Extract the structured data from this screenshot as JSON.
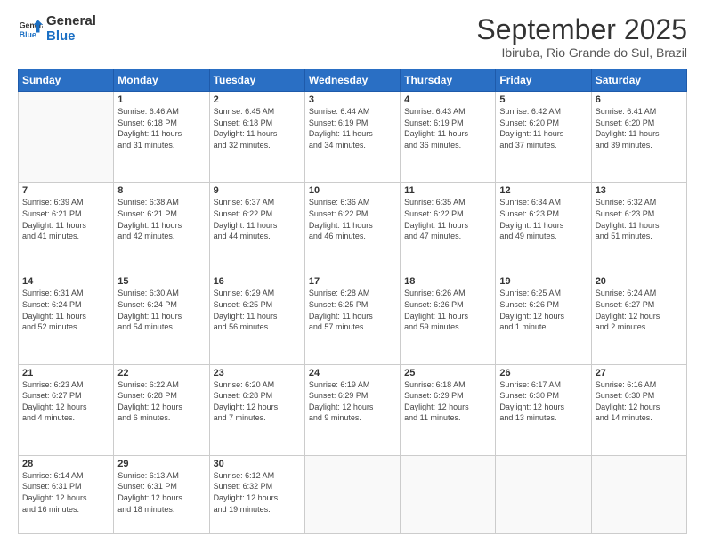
{
  "logo": {
    "general": "General",
    "blue": "Blue"
  },
  "header": {
    "month": "September 2025",
    "location": "Ibiruba, Rio Grande do Sul, Brazil"
  },
  "weekdays": [
    "Sunday",
    "Monday",
    "Tuesday",
    "Wednesday",
    "Thursday",
    "Friday",
    "Saturday"
  ],
  "weeks": [
    [
      {
        "day": "",
        "info": ""
      },
      {
        "day": "1",
        "info": "Sunrise: 6:46 AM\nSunset: 6:18 PM\nDaylight: 11 hours\nand 31 minutes."
      },
      {
        "day": "2",
        "info": "Sunrise: 6:45 AM\nSunset: 6:18 PM\nDaylight: 11 hours\nand 32 minutes."
      },
      {
        "day": "3",
        "info": "Sunrise: 6:44 AM\nSunset: 6:19 PM\nDaylight: 11 hours\nand 34 minutes."
      },
      {
        "day": "4",
        "info": "Sunrise: 6:43 AM\nSunset: 6:19 PM\nDaylight: 11 hours\nand 36 minutes."
      },
      {
        "day": "5",
        "info": "Sunrise: 6:42 AM\nSunset: 6:20 PM\nDaylight: 11 hours\nand 37 minutes."
      },
      {
        "day": "6",
        "info": "Sunrise: 6:41 AM\nSunset: 6:20 PM\nDaylight: 11 hours\nand 39 minutes."
      }
    ],
    [
      {
        "day": "7",
        "info": "Sunrise: 6:39 AM\nSunset: 6:21 PM\nDaylight: 11 hours\nand 41 minutes."
      },
      {
        "day": "8",
        "info": "Sunrise: 6:38 AM\nSunset: 6:21 PM\nDaylight: 11 hours\nand 42 minutes."
      },
      {
        "day": "9",
        "info": "Sunrise: 6:37 AM\nSunset: 6:22 PM\nDaylight: 11 hours\nand 44 minutes."
      },
      {
        "day": "10",
        "info": "Sunrise: 6:36 AM\nSunset: 6:22 PM\nDaylight: 11 hours\nand 46 minutes."
      },
      {
        "day": "11",
        "info": "Sunrise: 6:35 AM\nSunset: 6:22 PM\nDaylight: 11 hours\nand 47 minutes."
      },
      {
        "day": "12",
        "info": "Sunrise: 6:34 AM\nSunset: 6:23 PM\nDaylight: 11 hours\nand 49 minutes."
      },
      {
        "day": "13",
        "info": "Sunrise: 6:32 AM\nSunset: 6:23 PM\nDaylight: 11 hours\nand 51 minutes."
      }
    ],
    [
      {
        "day": "14",
        "info": "Sunrise: 6:31 AM\nSunset: 6:24 PM\nDaylight: 11 hours\nand 52 minutes."
      },
      {
        "day": "15",
        "info": "Sunrise: 6:30 AM\nSunset: 6:24 PM\nDaylight: 11 hours\nand 54 minutes."
      },
      {
        "day": "16",
        "info": "Sunrise: 6:29 AM\nSunset: 6:25 PM\nDaylight: 11 hours\nand 56 minutes."
      },
      {
        "day": "17",
        "info": "Sunrise: 6:28 AM\nSunset: 6:25 PM\nDaylight: 11 hours\nand 57 minutes."
      },
      {
        "day": "18",
        "info": "Sunrise: 6:26 AM\nSunset: 6:26 PM\nDaylight: 11 hours\nand 59 minutes."
      },
      {
        "day": "19",
        "info": "Sunrise: 6:25 AM\nSunset: 6:26 PM\nDaylight: 12 hours\nand 1 minute."
      },
      {
        "day": "20",
        "info": "Sunrise: 6:24 AM\nSunset: 6:27 PM\nDaylight: 12 hours\nand 2 minutes."
      }
    ],
    [
      {
        "day": "21",
        "info": "Sunrise: 6:23 AM\nSunset: 6:27 PM\nDaylight: 12 hours\nand 4 minutes."
      },
      {
        "day": "22",
        "info": "Sunrise: 6:22 AM\nSunset: 6:28 PM\nDaylight: 12 hours\nand 6 minutes."
      },
      {
        "day": "23",
        "info": "Sunrise: 6:20 AM\nSunset: 6:28 PM\nDaylight: 12 hours\nand 7 minutes."
      },
      {
        "day": "24",
        "info": "Sunrise: 6:19 AM\nSunset: 6:29 PM\nDaylight: 12 hours\nand 9 minutes."
      },
      {
        "day": "25",
        "info": "Sunrise: 6:18 AM\nSunset: 6:29 PM\nDaylight: 12 hours\nand 11 minutes."
      },
      {
        "day": "26",
        "info": "Sunrise: 6:17 AM\nSunset: 6:30 PM\nDaylight: 12 hours\nand 13 minutes."
      },
      {
        "day": "27",
        "info": "Sunrise: 6:16 AM\nSunset: 6:30 PM\nDaylight: 12 hours\nand 14 minutes."
      }
    ],
    [
      {
        "day": "28",
        "info": "Sunrise: 6:14 AM\nSunset: 6:31 PM\nDaylight: 12 hours\nand 16 minutes."
      },
      {
        "day": "29",
        "info": "Sunrise: 6:13 AM\nSunset: 6:31 PM\nDaylight: 12 hours\nand 18 minutes."
      },
      {
        "day": "30",
        "info": "Sunrise: 6:12 AM\nSunset: 6:32 PM\nDaylight: 12 hours\nand 19 minutes."
      },
      {
        "day": "",
        "info": ""
      },
      {
        "day": "",
        "info": ""
      },
      {
        "day": "",
        "info": ""
      },
      {
        "day": "",
        "info": ""
      }
    ]
  ]
}
